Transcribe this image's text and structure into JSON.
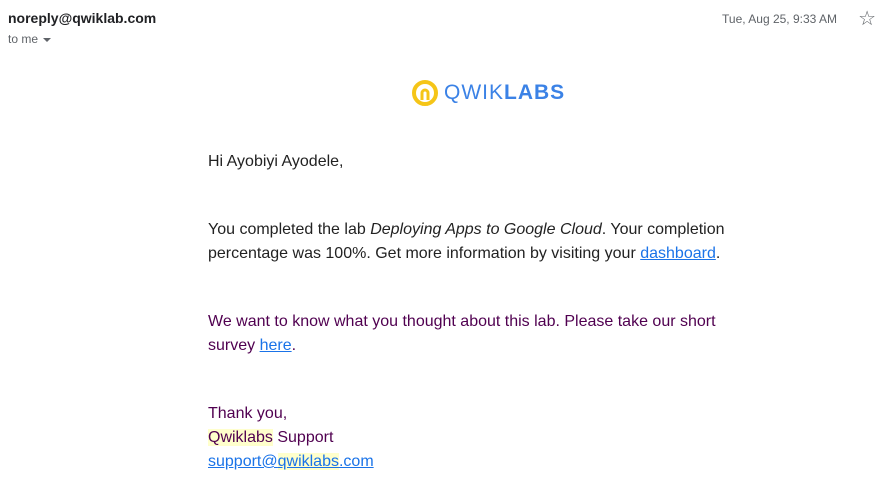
{
  "header": {
    "sender": "noreply@qwiklab.com",
    "recipient": "to me",
    "date": "Tue, Aug 25, 9:33 AM"
  },
  "logo": {
    "text_light": "QWIK",
    "text_bold": "LABS",
    "brand_color": "#3b82e6",
    "icon_color": "#f5c518"
  },
  "email": {
    "greeting": "Hi Ayobiyi Ayodele,",
    "p1_pre": "You completed the lab ",
    "p1_lab": "Deploying Apps to Google Cloud",
    "p1_mid": ". Your completion percentage was 100%. Get more information by visiting your ",
    "p1_link": "dashboard",
    "p1_end": ".",
    "p2_pre": "We want to know what you thought about this lab. Please take our short survey ",
    "p2_link": "here",
    "p2_end": ".",
    "thanks": "Thank you,",
    "sig_name_hl": "Qwiklabs",
    "sig_name_rest": " Support",
    "email_pre": "support@",
    "email_hl": "qwiklabs",
    "email_end": ".com"
  }
}
